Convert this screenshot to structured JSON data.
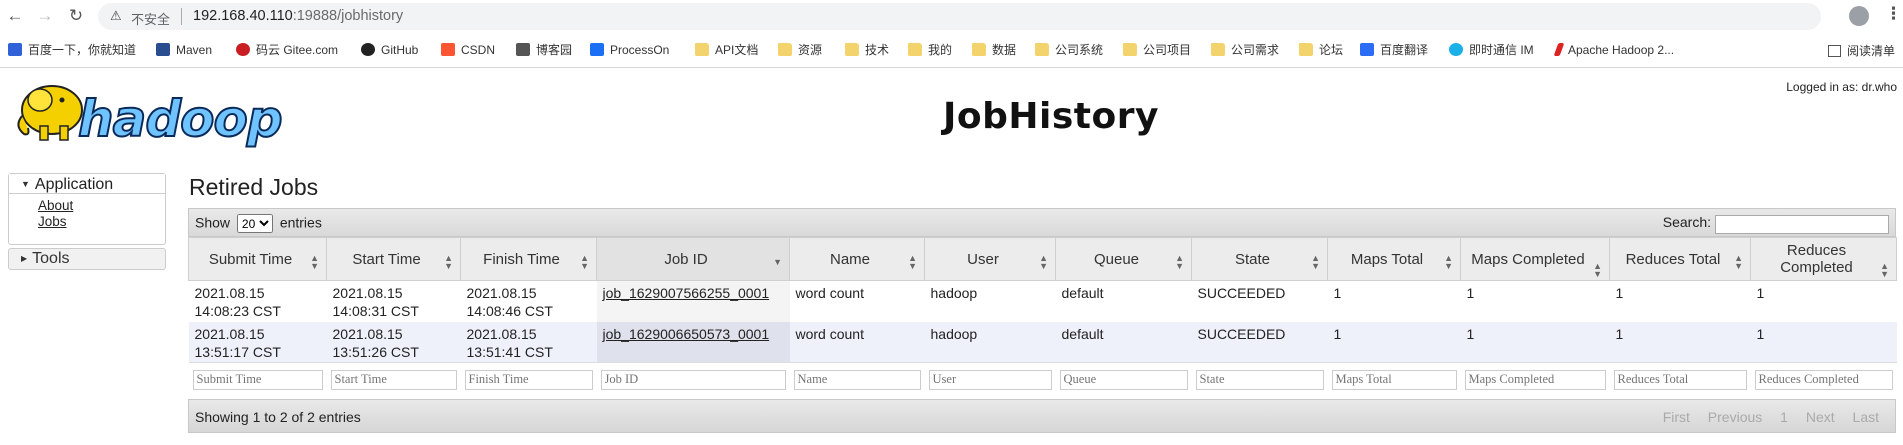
{
  "browser": {
    "insecure_label": "不安全",
    "url_host": "192.168.40.110",
    "url_path": ":19888/jobhistory",
    "bookmarks": [
      "百度一下，你就知道",
      "Maven",
      "码云 Gitee.com",
      "GitHub",
      "CSDN",
      "博客园",
      "ProcessOn",
      "API文档",
      "资源",
      "技术",
      "我的",
      "数据",
      "公司系统",
      "公司项目",
      "公司需求",
      "论坛",
      "百度翻译",
      "即时通信 IM",
      "Apache Hadoop 2..."
    ],
    "reading_list": "阅读清单"
  },
  "header": {
    "logo_text": "hadoop",
    "title": "JobHistory",
    "logged_in": "Logged in as: dr.who"
  },
  "sidebar": {
    "application_label": "Application",
    "items": [
      "About",
      "Jobs"
    ],
    "tools_label": "Tools"
  },
  "main": {
    "title": "Retired Jobs",
    "show_label": "Show",
    "page_size": "20",
    "entries_label": "entries",
    "search_label": "Search:",
    "columns": [
      "Submit Time",
      "Start Time",
      "Finish Time",
      "Job ID",
      "Name",
      "User",
      "Queue",
      "State",
      "Maps Total",
      "Maps Completed",
      "Reduces Total",
      "Reduces Completed"
    ],
    "rows": [
      [
        "2021.08.15 14:08:23 CST",
        "2021.08.15 14:08:31 CST",
        "2021.08.15 14:08:46 CST",
        "job_1629007566255_0001",
        "word count",
        "hadoop",
        "default",
        "SUCCEEDED",
        "1",
        "1",
        "1",
        "1"
      ],
      [
        "2021.08.15 13:51:17 CST",
        "2021.08.15 13:51:26 CST",
        "2021.08.15 13:51:41 CST",
        "job_1629006650573_0001",
        "word count",
        "hadoop",
        "default",
        "SUCCEEDED",
        "1",
        "1",
        "1",
        "1"
      ]
    ],
    "filter_placeholders": [
      "Submit Time",
      "Start Time",
      "Finish Time",
      "Job ID",
      "Name",
      "User",
      "Queue",
      "State",
      "Maps Total",
      "Maps Completed",
      "Reduces Total",
      "Reduces Completed"
    ],
    "showing_text": "Showing 1 to 2 of 2 entries",
    "pager": [
      "First",
      "Previous",
      "1",
      "Next",
      "Last"
    ]
  }
}
